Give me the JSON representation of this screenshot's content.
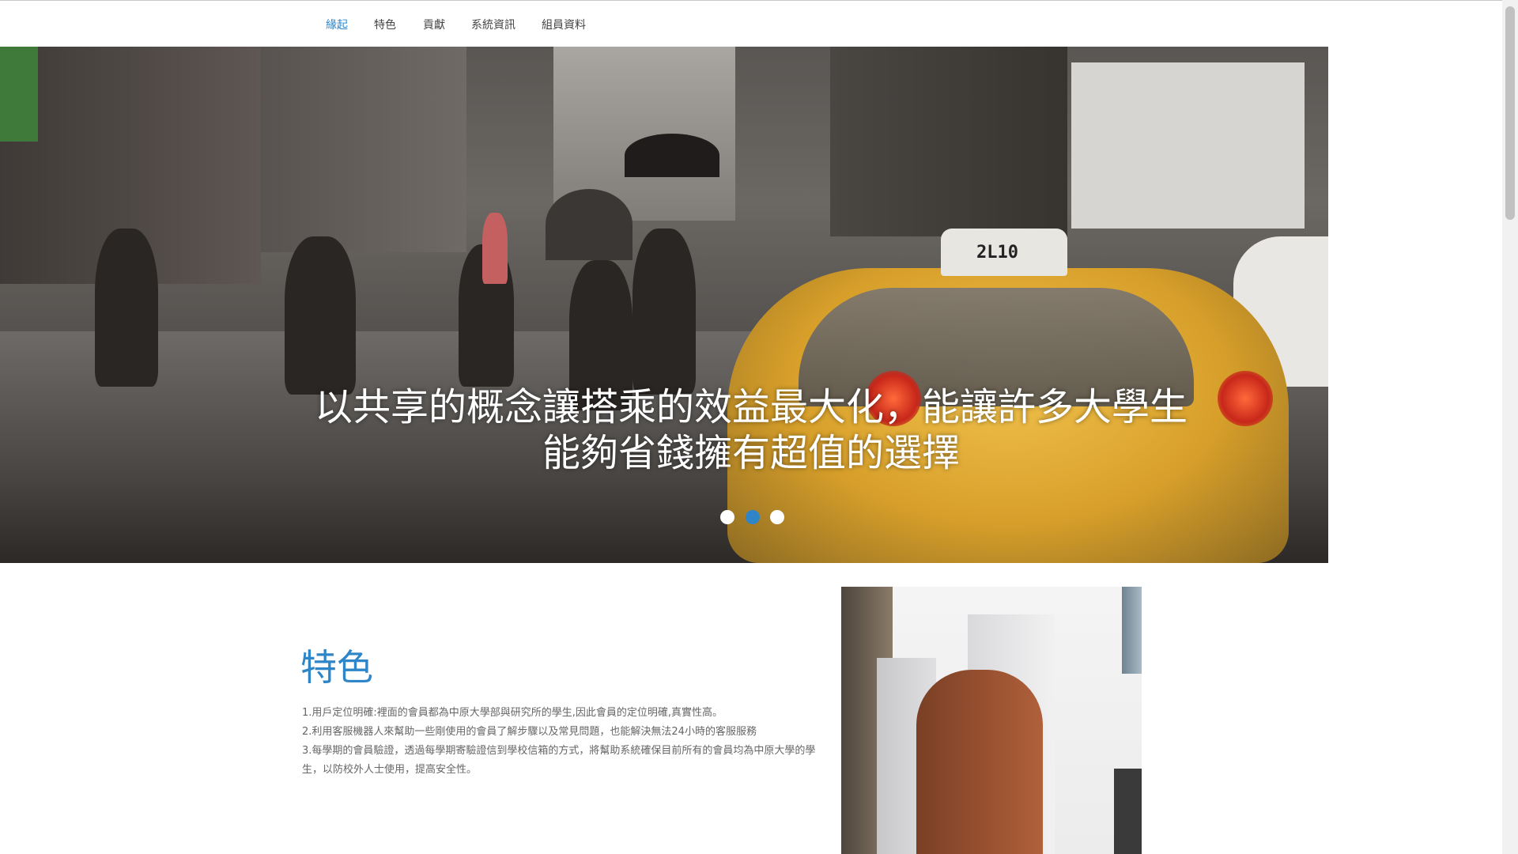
{
  "nav": {
    "items": [
      {
        "label": "緣起",
        "active": true
      },
      {
        "label": "特色",
        "active": false
      },
      {
        "label": "貢獻",
        "active": false
      },
      {
        "label": "系統資訊",
        "active": false
      },
      {
        "label": "組員資料",
        "active": false
      }
    ]
  },
  "hero": {
    "image": "rainy-city-street-taxi-photo",
    "caption_line1": "以共享的概念讓搭乘的效益最大化，能讓許多大學生",
    "caption_line2": "能夠省錢擁有超值的選擇",
    "taxi_sign": "2L10",
    "slides_total": 3,
    "active_slide": 2
  },
  "features": {
    "title": "特色",
    "items": [
      "1.用戶定位明確:裡面的會員都為中原大學部與研究所的學生,因此會員的定位明確,真實性高。",
      "2.利用客服機器人來幫助一些剛使用的會員了解步驟以及常見問題，也能解決無法24小時的客服服務",
      "3.每學期的會員驗證，透過每學期寄驗證信到學校信箱的方式，將幫助系統確保目前所有的會員均為中原大學的學生，以防校外人士使用，提高安全性。"
    ],
    "image": "city-buildings-photo"
  },
  "colors": {
    "accent": "#2e86c8",
    "text": "#666666"
  }
}
